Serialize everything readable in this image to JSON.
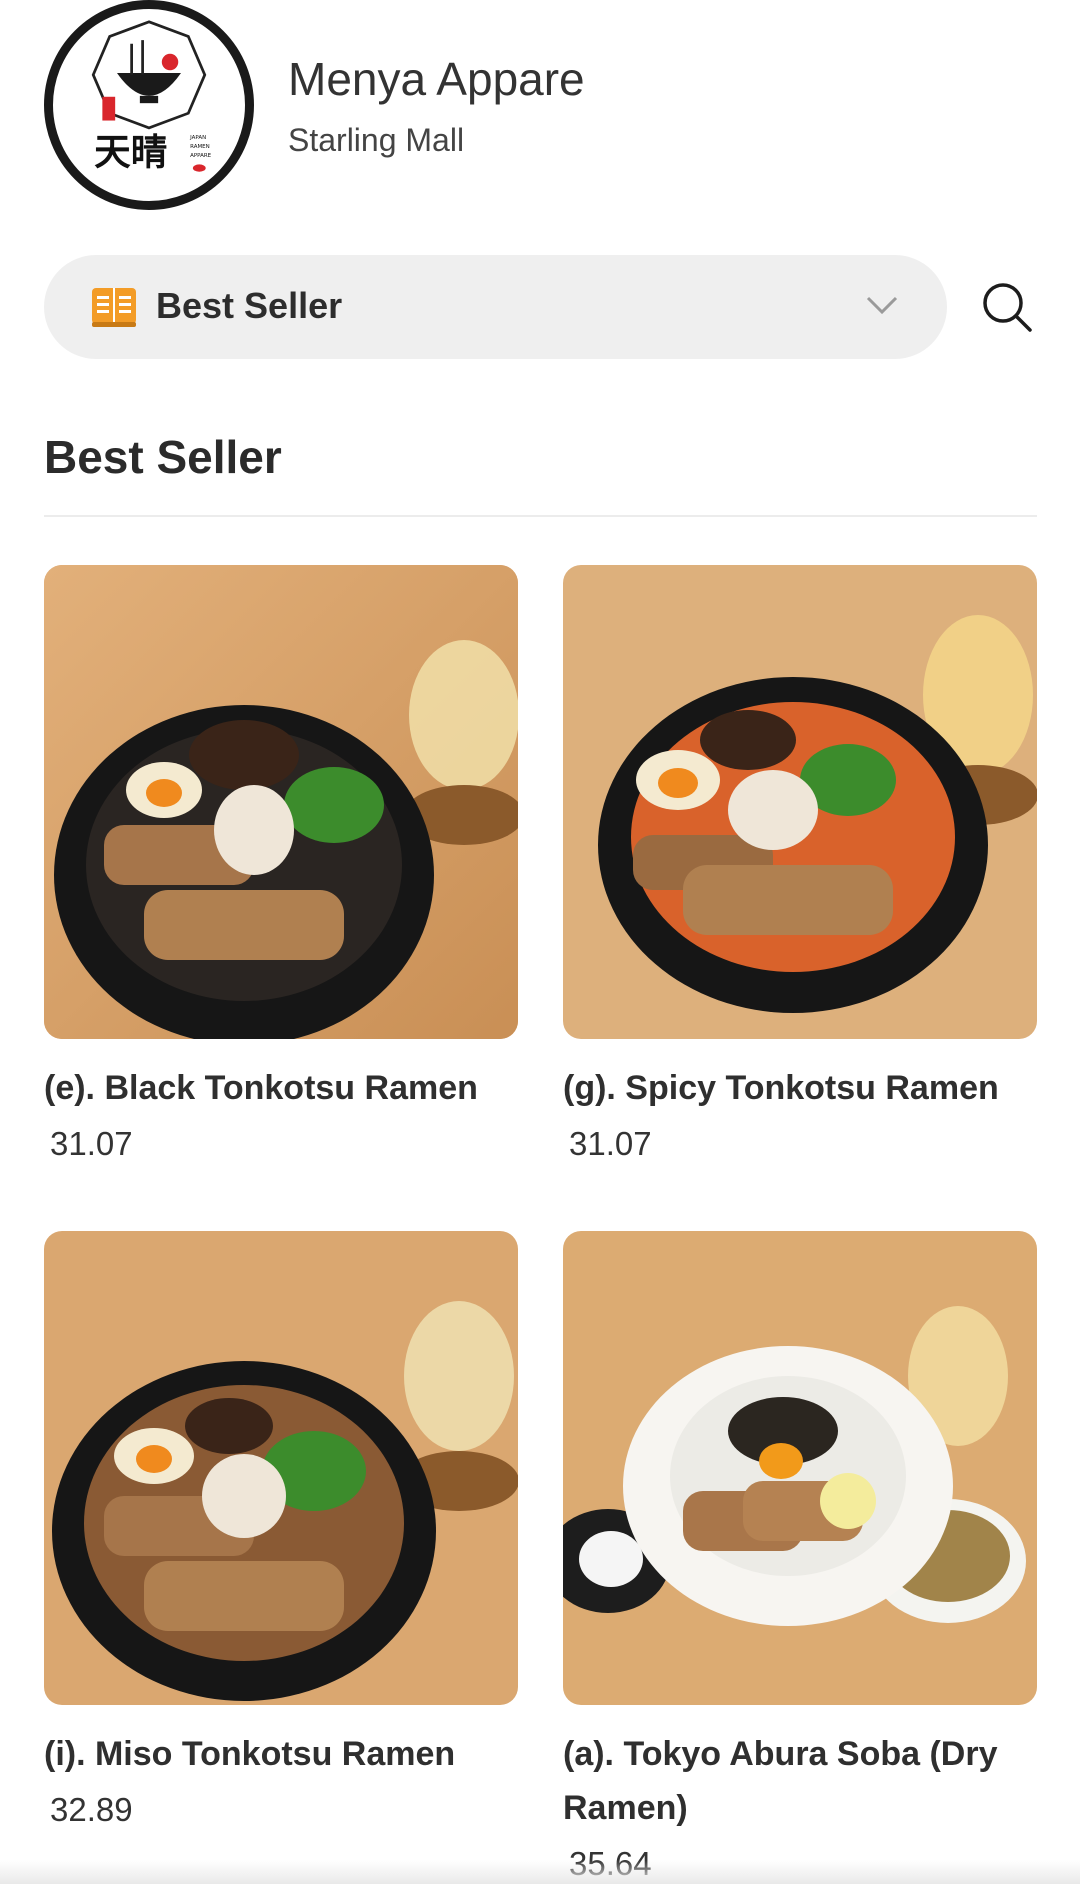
{
  "store": {
    "name": "Menya Appare",
    "branch": "Starling Mall",
    "logo_text": "天晴",
    "logo_subtext": "JAPAN RAMEN APPARE"
  },
  "category_selector": {
    "selected": "Best Seller",
    "icon": "menu-book-icon",
    "accent": "#f39c27"
  },
  "section": {
    "title": "Best Seller"
  },
  "products": [
    {
      "name": "(e). Black Tonkotsu Ramen",
      "price": "31.07",
      "broth": "#2a2522"
    },
    {
      "name": "(g). Spicy Tonkotsu Ramen",
      "price": "31.07",
      "broth": "#d9622b"
    },
    {
      "name": "(i). Miso Tonkotsu Ramen",
      "price": "32.89",
      "broth": "#8a5a34"
    },
    {
      "name": "(a). Tokyo Abura Soba (Dry Ramen)",
      "price": "35.64",
      "broth": "#f7f5f1"
    }
  ]
}
